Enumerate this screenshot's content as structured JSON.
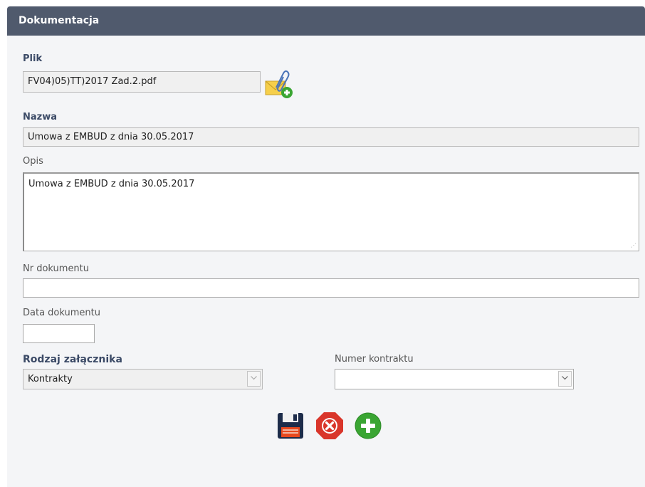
{
  "panel": {
    "title": "Dokumentacja"
  },
  "file": {
    "label": "Plik",
    "value": "FV04)05)TT)2017 Zad.2.pdf",
    "attach_icon": "attach-file-icon"
  },
  "name": {
    "label": "Nazwa",
    "value": "Umowa z EMBUD z dnia 30.05.2017"
  },
  "description": {
    "label": "Opis",
    "value": "Umowa z EMBUD z dnia 30.05.2017"
  },
  "document_number": {
    "label": "Nr dokumentu",
    "value": ""
  },
  "document_date": {
    "label": "Data dokumentu",
    "value": ""
  },
  "attachment_type": {
    "label": "Rodzaj załącznika",
    "selected": "Kontrakty"
  },
  "contract_number": {
    "label": "Numer kontraktu",
    "selected": ""
  },
  "actions": {
    "save_icon": "save-icon",
    "cancel_icon": "cancel-icon",
    "add_icon": "add-icon"
  },
  "colors": {
    "header_bg": "#505a6d",
    "label_bold": "#3b4a66",
    "cancel_red": "#d9362b",
    "add_green": "#3aa533"
  }
}
